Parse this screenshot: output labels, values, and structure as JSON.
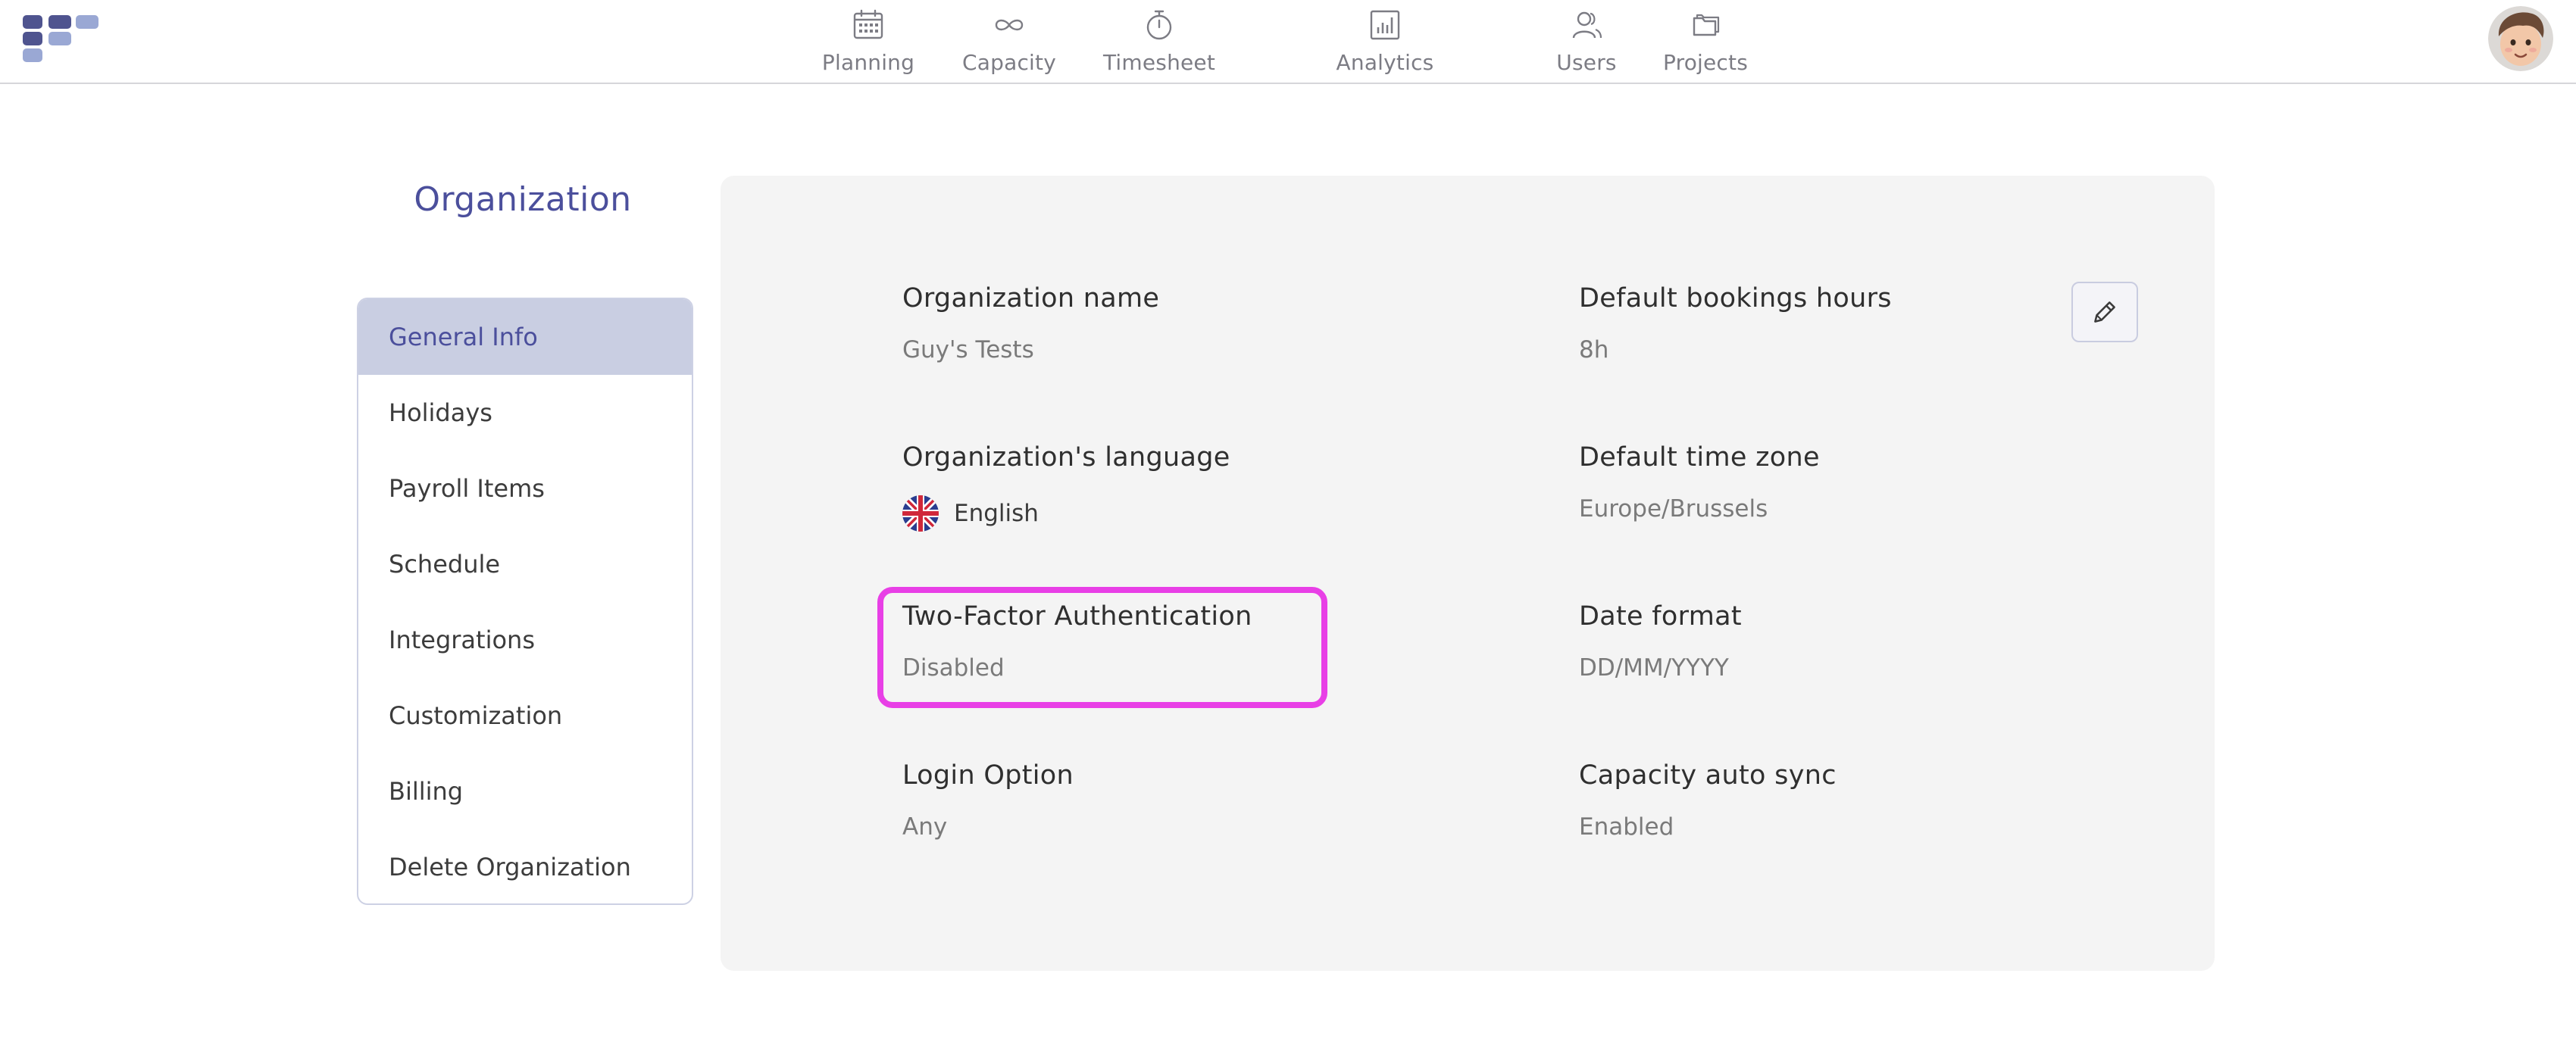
{
  "colors": {
    "accent": "#4b4f9c",
    "active_menu_bg": "#c9cee2",
    "highlight_box": "#e83fe6",
    "panel_bg": "#f4f4f4"
  },
  "nav": {
    "items": [
      {
        "label": "Planning",
        "icon": "calendar-icon"
      },
      {
        "label": "Capacity",
        "icon": "infinity-icon"
      },
      {
        "label": "Timesheet",
        "icon": "stopwatch-icon"
      },
      {
        "label": "Analytics",
        "icon": "bar-chart-icon"
      },
      {
        "label": "Users",
        "icon": "users-icon"
      },
      {
        "label": "Projects",
        "icon": "folders-icon"
      }
    ]
  },
  "sidebar": {
    "title": "Organization",
    "items": [
      {
        "label": "General Info",
        "active": true
      },
      {
        "label": "Holidays"
      },
      {
        "label": "Payroll Items"
      },
      {
        "label": "Schedule"
      },
      {
        "label": "Integrations"
      },
      {
        "label": "Customization"
      },
      {
        "label": "Billing"
      },
      {
        "label": "Delete Organization"
      }
    ]
  },
  "general_info": {
    "org_name": {
      "label": "Organization name",
      "value": "Guy's Tests"
    },
    "booking_hours": {
      "label": "Default bookings hours",
      "value": "8h"
    },
    "language": {
      "label": "Organization's language",
      "value": "English",
      "icon": "uk-flag-icon"
    },
    "time_zone": {
      "label": "Default time zone",
      "value": "Europe/Brussels"
    },
    "two_factor": {
      "label": "Two-Factor Authentication",
      "value": "Disabled"
    },
    "date_format": {
      "label": "Date format",
      "value": "DD/MM/YYYY"
    },
    "login_option": {
      "label": "Login Option",
      "value": "Any"
    },
    "capacity_sync": {
      "label": "Capacity auto sync",
      "value": "Enabled"
    },
    "edit_icon": "pencil-icon"
  }
}
